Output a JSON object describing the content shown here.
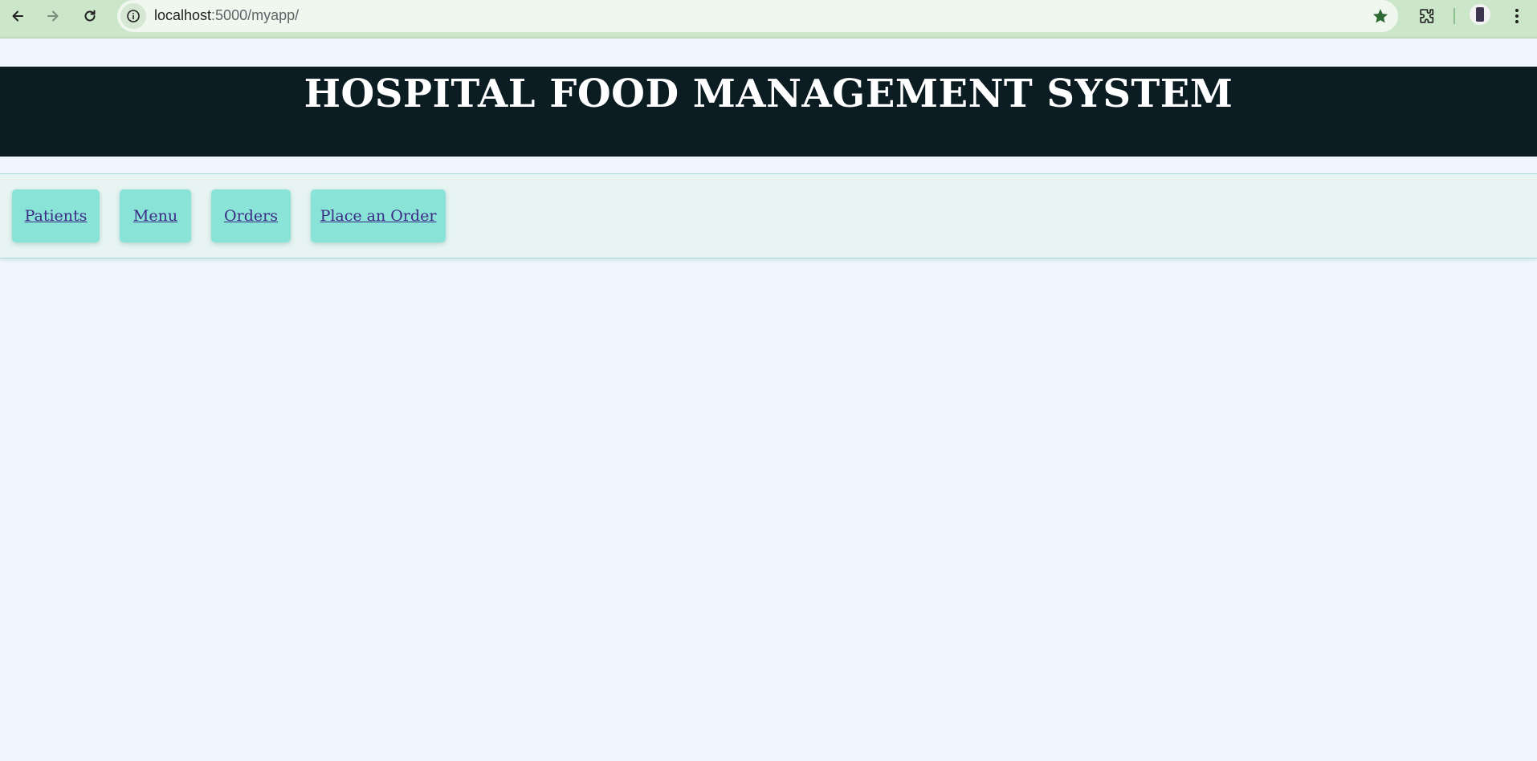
{
  "browser": {
    "url_host": "localhost",
    "url_rest": ":5000/myapp/",
    "icons": {
      "back": "back-arrow-icon",
      "forward": "forward-arrow-icon",
      "reload": "reload-icon",
      "site_info": "info-icon",
      "bookmark": "star-icon",
      "extensions": "puzzle-icon",
      "profile": "avatar",
      "menu": "kebab-menu-icon"
    },
    "colors": {
      "toolbar": "#cbe6c9",
      "omnibox": "#eff7ee",
      "star": "#2e6b34"
    }
  },
  "header": {
    "title": "HOSPITAL FOOD MANAGEMENT SYSTEM",
    "colors": {
      "background": "#0b1c23",
      "text": "#ffffff"
    }
  },
  "nav": {
    "items": [
      {
        "label": "Patients"
      },
      {
        "label": "Menu"
      },
      {
        "label": "Orders"
      },
      {
        "label": "Place an Order"
      }
    ],
    "colors": {
      "bar": "#e7f4f2",
      "button": "#8ae3d7",
      "link": "#3b2a86"
    }
  },
  "page": {
    "colors": {
      "background": "#f0f6fe"
    }
  }
}
